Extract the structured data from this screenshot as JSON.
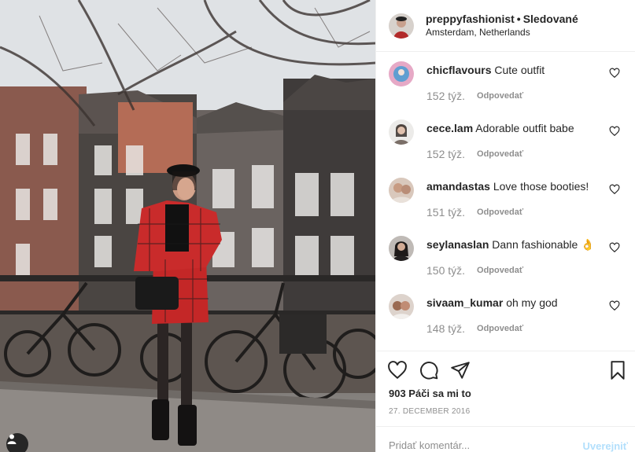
{
  "header": {
    "username": "preppyfashionist",
    "separator": "•",
    "follow_status": "Sledované",
    "location": "Amsterdam, Netherlands"
  },
  "comments": [
    {
      "username": "chicflavours",
      "text": "Cute outfit",
      "time": "152 týž.",
      "reply": "Odpovedať"
    },
    {
      "username": "cece.lam",
      "text": "Adorable outfit babe",
      "time": "152 týž.",
      "reply": "Odpovedať"
    },
    {
      "username": "amandastas",
      "text": "Love those booties!",
      "time": "151 týž.",
      "reply": "Odpovedať"
    },
    {
      "username": "seylanaslan",
      "text": "Dann fashionable 👌",
      "time": "150 týž.",
      "reply": "Odpovedať"
    },
    {
      "username": "sivaam_kumar",
      "text": "oh my god",
      "time": "148 týž.",
      "reply": "Odpovedať"
    }
  ],
  "actions": {
    "likes": "903 Páči sa mi to",
    "date": "27. DECEMBER 2016",
    "icons": [
      "heart-icon",
      "comment-icon",
      "share-icon",
      "bookmark-icon"
    ]
  },
  "composer": {
    "placeholder": "Pridať komentár...",
    "post_label": "Uverejniť"
  },
  "colors": {
    "text": "#262626",
    "muted": "#8e8e8e",
    "divider": "#efefef",
    "post_disabled": "#b2dffc"
  }
}
